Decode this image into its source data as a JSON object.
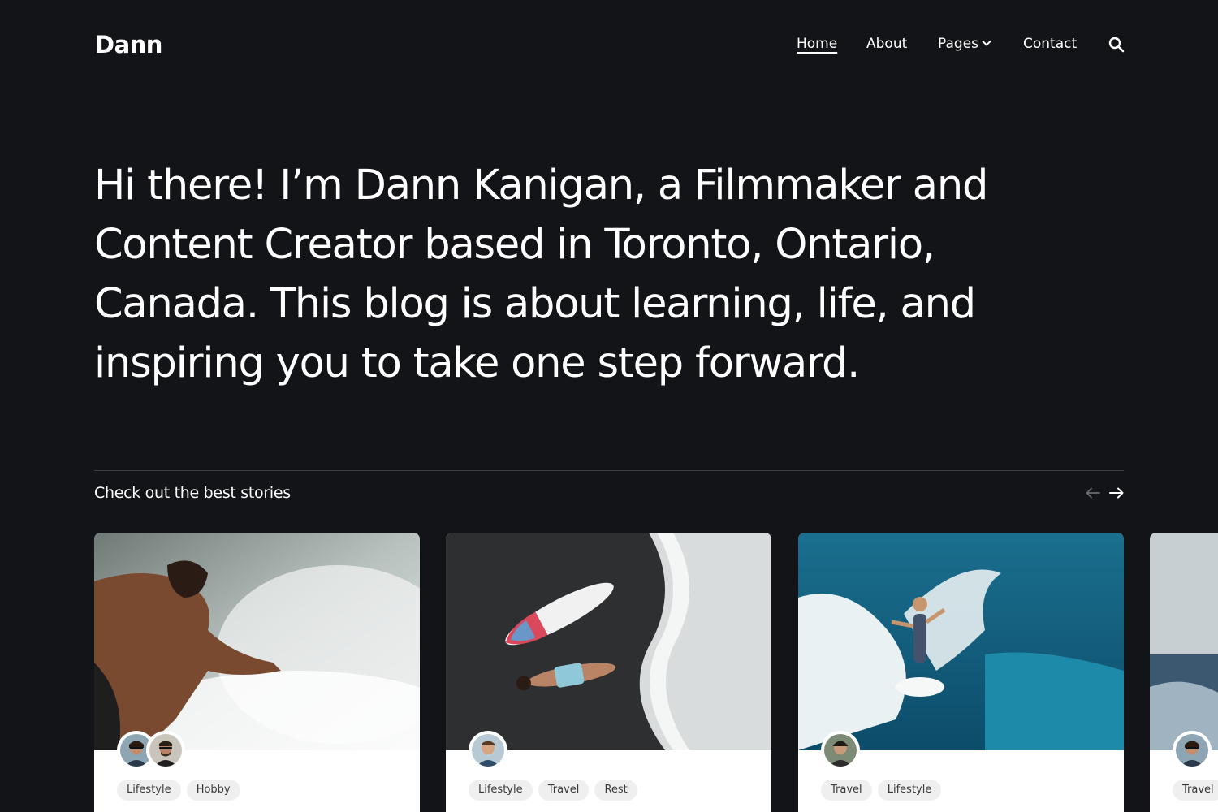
{
  "header": {
    "logo": "Dann",
    "nav": {
      "home": "Home",
      "about": "About",
      "pages": "Pages",
      "contact": "Contact"
    }
  },
  "hero": {
    "text": "Hi there! I’m Dann Kanigan, a Filmmaker and Content Creator based in Toronto, Ontario, Canada. This blog is about learning, life, and inspiring you to take one step forward."
  },
  "stories": {
    "title": "Check out the best stories",
    "cards": [
      {
        "tags": [
          "Lifestyle",
          "Hobby"
        ]
      },
      {
        "tags": [
          "Lifestyle",
          "Travel",
          "Rest"
        ]
      },
      {
        "tags": [
          "Travel",
          "Lifestyle"
        ]
      },
      {
        "tags": [
          "Travel"
        ]
      }
    ]
  },
  "colors": {
    "background": "#131417",
    "text": "#ffffff",
    "divider": "#3c3d41",
    "tag_background": "#efefef",
    "tag_text": "#3a3a3a"
  }
}
